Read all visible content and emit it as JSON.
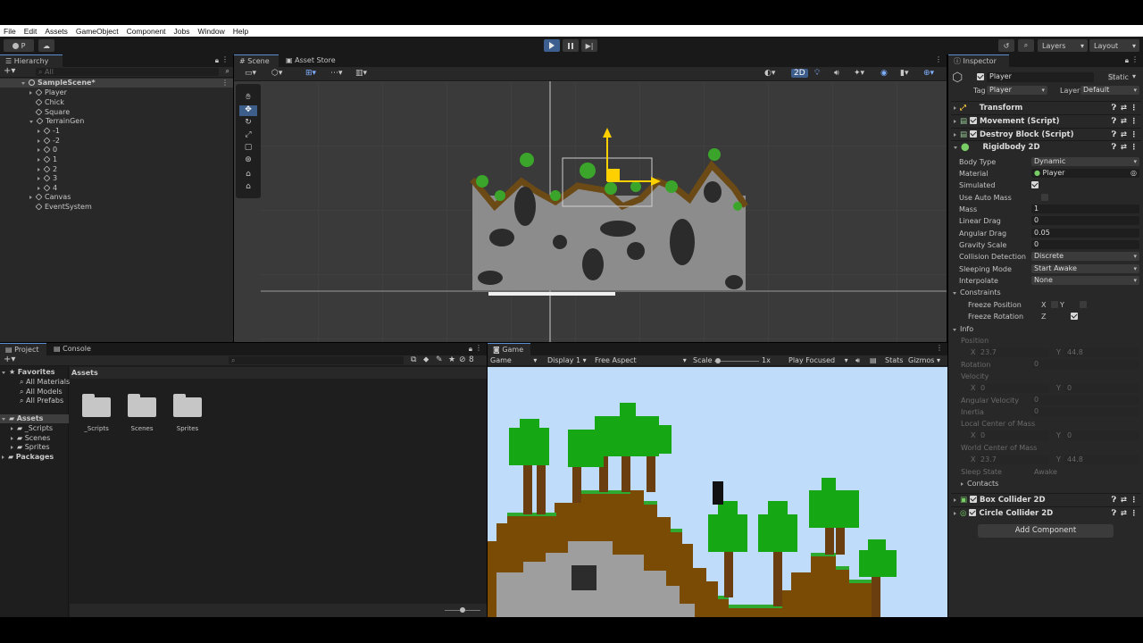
{
  "menu": [
    "File",
    "Edit",
    "Assets",
    "GameObject",
    "Component",
    "Jobs",
    "Window",
    "Help"
  ],
  "toolbar": {
    "account": "P",
    "layers": "Layers",
    "layout": "Layout"
  },
  "hierarchy": {
    "tab": "Hierarchy",
    "search_placeholder": "All",
    "scene": "SampleScene*",
    "items": [
      {
        "label": "Player"
      },
      {
        "label": "Chick"
      },
      {
        "label": "Square"
      },
      {
        "label": "TerrainGen"
      },
      {
        "label": "-1"
      },
      {
        "label": "-2"
      },
      {
        "label": "0"
      },
      {
        "label": "1"
      },
      {
        "label": "2"
      },
      {
        "label": "3"
      },
      {
        "label": "4"
      },
      {
        "label": "Canvas"
      },
      {
        "label": "EventSystem"
      }
    ]
  },
  "scene_view": {
    "tabs": [
      "Scene",
      "Asset Store"
    ],
    "mode_2d": "2D"
  },
  "project": {
    "tabs": [
      "Project",
      "Console"
    ],
    "favorites": "Favorites",
    "fav_items": [
      "All Materials",
      "All Models",
      "All Prefabs"
    ],
    "assets_root": "Assets",
    "asset_children": [
      "_Scripts",
      "Scenes",
      "Sprites"
    ],
    "packages": "Packages",
    "breadcrumb": "Assets",
    "folders": [
      "_Scripts",
      "Scenes",
      "Sprites"
    ],
    "hidden_count": "8"
  },
  "game_view": {
    "tab": "Game",
    "mode": "Game",
    "display": "Display 1",
    "aspect": "Free Aspect",
    "scale_label": "Scale",
    "scale_value": "1x",
    "play_focused": "Play Focused",
    "stats": "Stats",
    "gizmos": "Gizmos"
  },
  "inspector": {
    "tab": "Inspector",
    "object_name": "Player",
    "static_label": "Static",
    "tag_label": "Tag",
    "tag_value": "Player",
    "layer_label": "Layer",
    "layer_value": "Default",
    "components": {
      "transform": "Transform",
      "movement": "Movement (Script)",
      "destroy": "Destroy Block (Script)",
      "rigidbody": "Rigidbody 2D",
      "box": "Box Collider 2D",
      "circle": "Circle Collider 2D"
    },
    "rb": {
      "body_type": {
        "label": "Body Type",
        "value": "Dynamic"
      },
      "material": {
        "label": "Material",
        "value": "Player"
      },
      "simulated": {
        "label": "Simulated"
      },
      "auto_mass": {
        "label": "Use Auto Mass"
      },
      "mass": {
        "label": "Mass",
        "value": "1"
      },
      "linear_drag": {
        "label": "Linear Drag",
        "value": "0"
      },
      "angular_drag": {
        "label": "Angular Drag",
        "value": "0.05"
      },
      "gravity": {
        "label": "Gravity Scale",
        "value": "0"
      },
      "collision": {
        "label": "Collision Detection",
        "value": "Discrete"
      },
      "sleeping": {
        "label": "Sleeping Mode",
        "value": "Start Awake"
      },
      "interpolate": {
        "label": "Interpolate",
        "value": "None"
      },
      "constraints": "Constraints",
      "freeze_pos": "Freeze Position",
      "freeze_rot": "Freeze Rotation",
      "x": "X",
      "y": "Y",
      "z": "Z"
    },
    "info": {
      "title": "Info",
      "position": "Position",
      "pos_x": "23.7",
      "pos_y": "44.8",
      "rotation": "Rotation",
      "rot": "0",
      "velocity": "Velocity",
      "vel_x": "0",
      "vel_y": "0",
      "ang_vel": "Angular Velocity",
      "ang_vel_v": "0",
      "inertia": "Inertia",
      "inertia_v": "0",
      "local_com": "Local Center of Mass",
      "lcom_x": "0",
      "lcom_y": "0",
      "world_com": "World Center of Mass",
      "wcom_x": "23.7",
      "wcom_y": "44.8",
      "sleep_state": "Sleep State",
      "sleep_v": "Awake",
      "contacts": "Contacts",
      "x": "X",
      "y": "Y"
    },
    "add_component": "Add Component"
  }
}
